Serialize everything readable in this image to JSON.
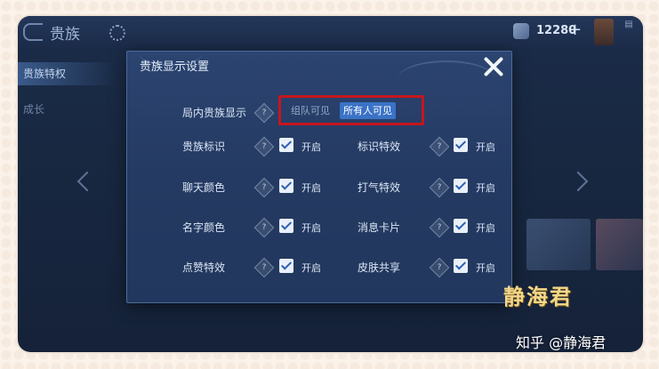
{
  "watermark": {
    "seal_text": "静海君",
    "zhihu_text": "知乎 @静海君"
  },
  "topbar": {
    "title": "贵族",
    "coin_count": "12280",
    "coin_plus": "+"
  },
  "side": {
    "item1": "贵族特权",
    "item2": "成长"
  },
  "dialog": {
    "title": "贵族显示设置",
    "visibility": {
      "label": "局内贵族显示",
      "options": [
        "组队可见",
        "所有人可见"
      ],
      "selected": "所有人可见"
    },
    "rows": [
      {
        "left_label": "贵族标识",
        "right_label": "标识特效"
      },
      {
        "left_label": "聊天颜色",
        "right_label": "打气特效"
      },
      {
        "left_label": "名字颜色",
        "right_label": "消息卡片"
      },
      {
        "left_label": "点赞特效",
        "right_label": "皮肤共享"
      }
    ],
    "on_text": "开启",
    "checked": true,
    "help_glyph": "?"
  },
  "colors": {
    "highlight_border": "#c5161d",
    "active_option": "#3a72c6"
  }
}
